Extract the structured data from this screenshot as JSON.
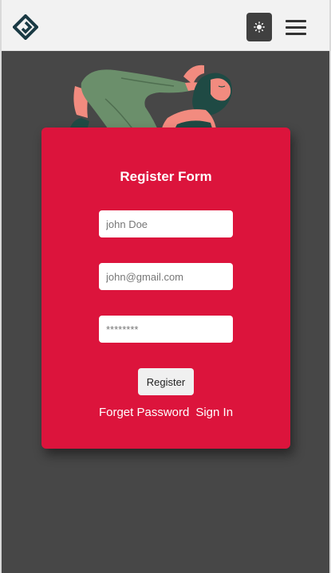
{
  "navbar": {
    "logo_icon": "logo-icon",
    "theme_toggle_icon": "sun-icon",
    "menu_icon": "hamburger-menu-icon"
  },
  "illustration": {
    "icon": "yoga-woman-illustration"
  },
  "register_form": {
    "title": "Register Form",
    "name_placeholder": "john Doe",
    "email_placeholder": "john@gmail.com",
    "password_placeholder": "********",
    "register_button": "Register",
    "forget_password_link": "Forget Password",
    "sign_in_link": "Sign In"
  },
  "colors": {
    "navbar_background": "#f2f2f2",
    "page_background": "#474747",
    "card_background": "#dc143c",
    "toggle_background": "#404040"
  }
}
